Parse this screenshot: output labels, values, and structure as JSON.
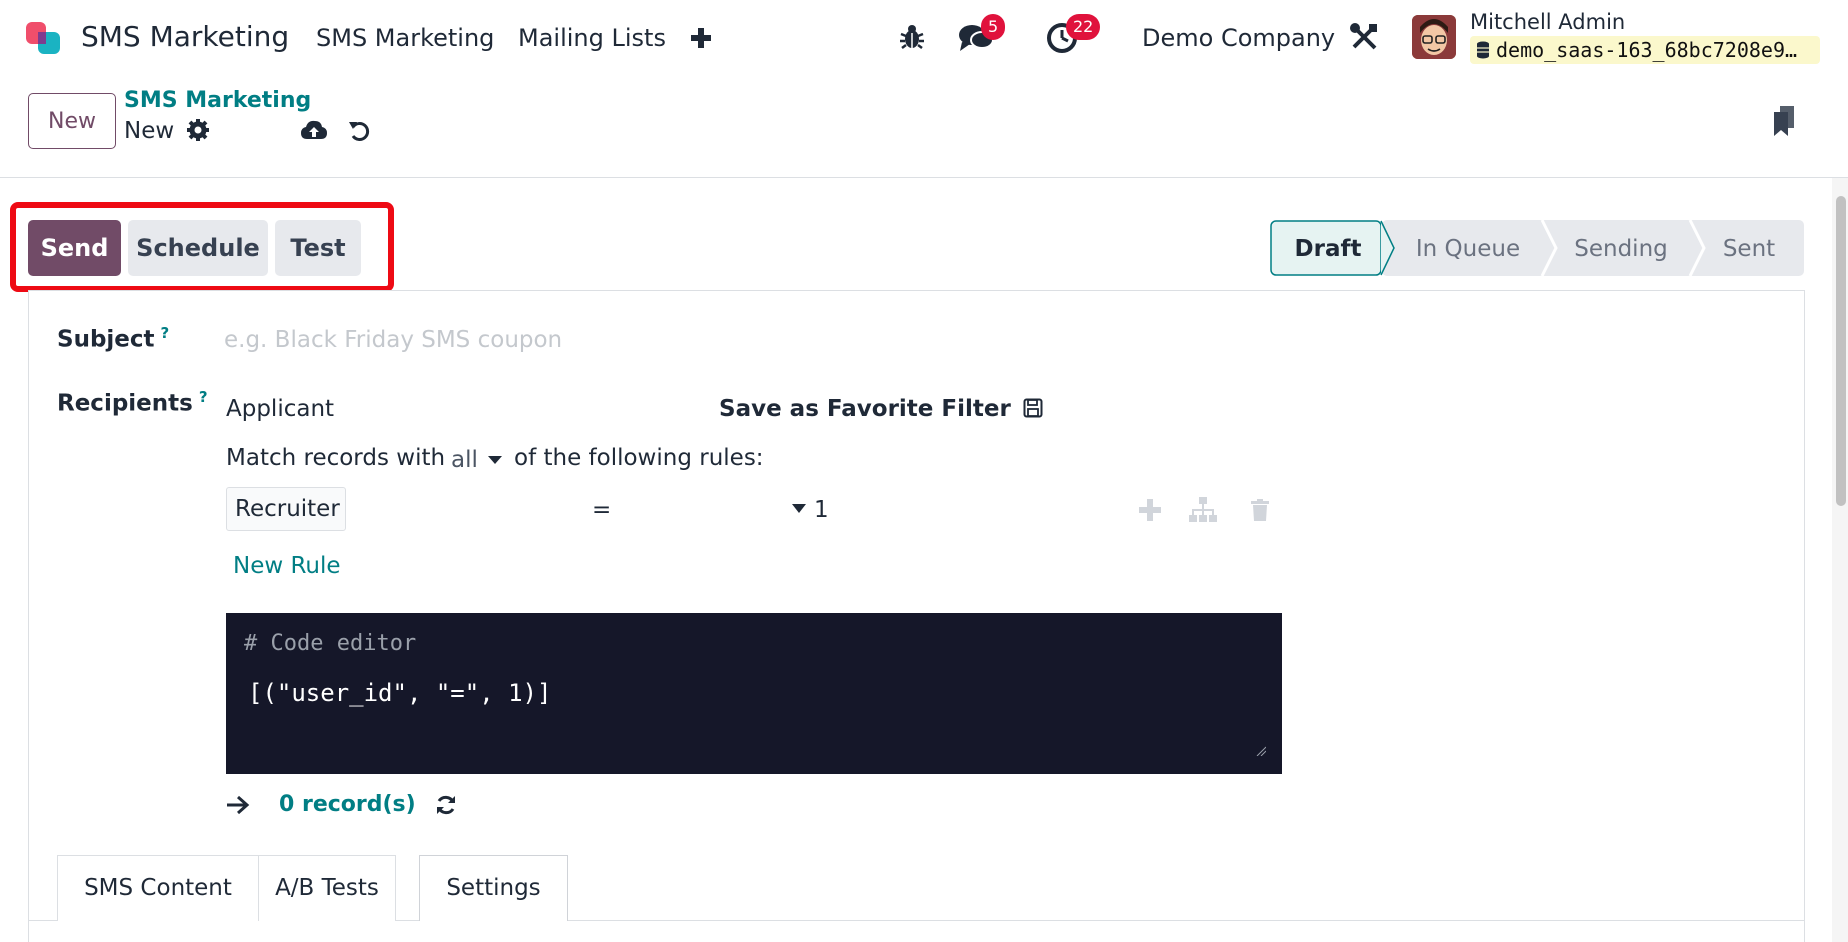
{
  "navbar": {
    "brand": "SMS Marketing",
    "menu": [
      "SMS Marketing",
      "Mailing Lists"
    ],
    "messages_count": "5",
    "activities_count": "22",
    "company": "Demo Company",
    "user_name": "Mitchell Admin",
    "database": "demo_saas-163_68bc7208e9…"
  },
  "control": {
    "new_label": "New",
    "breadcrumb_parent": "SMS Marketing",
    "breadcrumb_current": "New"
  },
  "actions": {
    "send": "Send",
    "schedule": "Schedule",
    "test": "Test"
  },
  "status": {
    "stages": [
      "Draft",
      "In Queue",
      "Sending",
      "Sent"
    ],
    "current": "Draft"
  },
  "form": {
    "subject_label": "Subject",
    "subject_placeholder": "e.g. Black Friday SMS coupon",
    "help_mark": "?",
    "recipients_label": "Recipients",
    "recipients_model": "Applicant",
    "save_favorite": "Save as Favorite Filter",
    "match_prefix": "Match records with",
    "match_mode": "all",
    "match_suffix": "of the following rules:",
    "rule": {
      "field": "Recruiter",
      "operator": "=",
      "value": "1"
    },
    "new_rule": "New Rule",
    "editor_comment": "# Code editor",
    "editor_code": "[(\"user_id\", \"=\", 1)]",
    "record_count": "0 record(s)"
  },
  "tabs": [
    {
      "label": "SMS Content"
    },
    {
      "label": "A/B Tests"
    },
    {
      "label": "Settings",
      "active": true
    }
  ],
  "colors": {
    "primary": "#714b67",
    "link": "#017e84",
    "highlight": "#ee0a14",
    "badge": "#e0123c",
    "editor_bg": "#151729"
  }
}
